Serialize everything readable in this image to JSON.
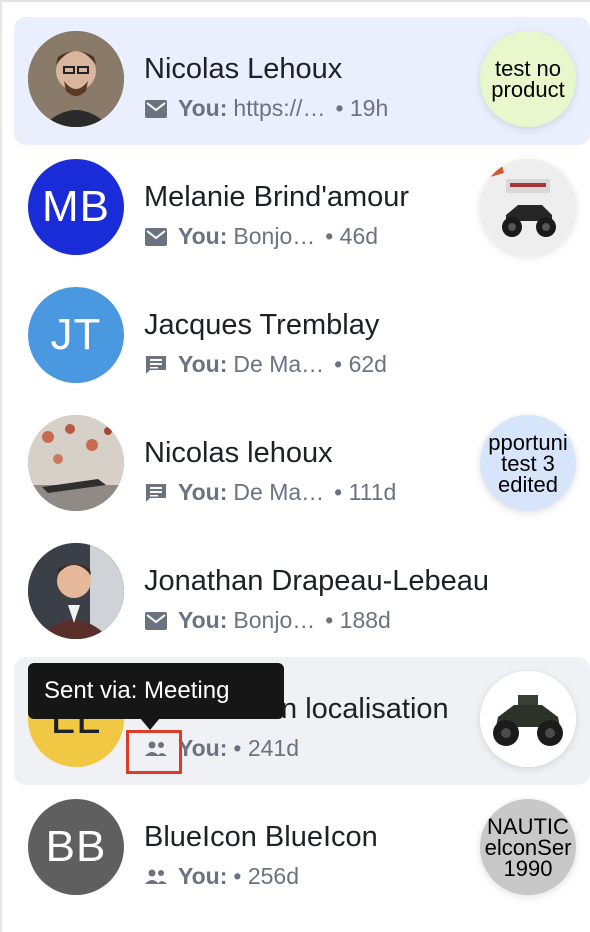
{
  "conversations": [
    {
      "name": "Nicolas Lehoux",
      "initials": "",
      "avatar_type": "photo",
      "avatar_color": "#6e5a4a",
      "channel_icon": "email-icon",
      "you_label": "You:",
      "preview": "https://…",
      "time": "• 19h",
      "thumb_text": "test no product",
      "thumb_color": "#e8f8cc",
      "state": "selected"
    },
    {
      "name": "Melanie Brind'amour",
      "initials": "MB",
      "avatar_type": "initials",
      "avatar_color": "#1a2bd8",
      "channel_icon": "email-icon",
      "you_label": "You:",
      "preview": "Bonjo…",
      "time": "• 46d",
      "thumb_text": "",
      "thumb_color": "#f4f4f4",
      "state": "normal"
    },
    {
      "name": "Jacques Tremblay",
      "initials": "JT",
      "avatar_type": "initials",
      "avatar_color": "#4a98e0",
      "channel_icon": "chat-icon",
      "you_label": "You:",
      "preview": "De Ma…",
      "time": "• 62d",
      "thumb_text": "",
      "thumb_color": "",
      "state": "normal"
    },
    {
      "name": "Nicolas lehoux",
      "initials": "",
      "avatar_type": "photo",
      "avatar_color": "#b9a89a",
      "channel_icon": "chat-icon",
      "you_label": "You:",
      "preview": "De Ma…",
      "time": "• 111d",
      "thumb_text": "pportuni test 3 edited",
      "thumb_color": "#d7e5fb",
      "state": "normal"
    },
    {
      "name": "Jonathan Drapeau-Lebeau",
      "initials": "",
      "avatar_type": "photo",
      "avatar_color": "#3a3f48",
      "channel_icon": "email-icon",
      "you_label": "You:",
      "preview": "Bonjo…",
      "time": "• 188d",
      "thumb_text": "",
      "thumb_color": "",
      "state": "normal"
    },
    {
      "name": "Localisation localisation",
      "initials": "LL",
      "avatar_type": "initials",
      "avatar_color": "#f0c843",
      "channel_icon": "people-icon",
      "you_label": "You:",
      "preview": "",
      "time": "• 241d",
      "thumb_text": "",
      "thumb_color": "#f4f4f4",
      "state": "hovered"
    },
    {
      "name": "BlueIcon BlueIcon",
      "initials": "BB",
      "avatar_type": "initials",
      "avatar_color": "#5f5f5f",
      "channel_icon": "people-icon",
      "you_label": "You:",
      "preview": "",
      "time": "• 256d",
      "thumb_text": "NAUTIC elconSer 1990",
      "thumb_color": "#c8c8c8",
      "state": "normal"
    }
  ],
  "tooltip": {
    "text": "Sent via: Meeting"
  }
}
